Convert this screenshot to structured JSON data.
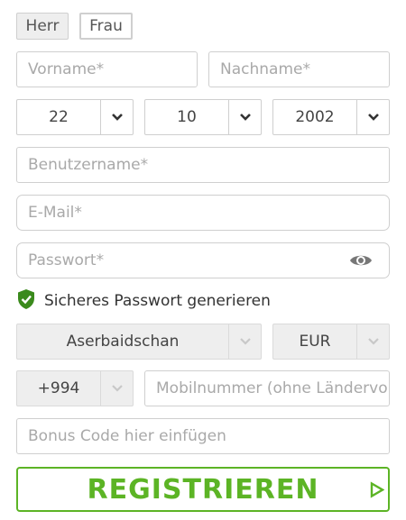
{
  "gender": {
    "options": [
      "Herr",
      "Frau"
    ],
    "selected": "Frau"
  },
  "first_name": {
    "placeholder": "Vorname*"
  },
  "last_name": {
    "placeholder": "Nachname*"
  },
  "birthdate": {
    "day": "22",
    "month": "10",
    "year": "2002"
  },
  "username": {
    "placeholder": "Benutzername*"
  },
  "email": {
    "placeholder": "E-Mail*"
  },
  "password": {
    "placeholder": "Passwort*"
  },
  "generate_password": {
    "label": "Sicheres Passwort generieren"
  },
  "country": {
    "value": "Aserbaidschan"
  },
  "currency": {
    "value": "EUR"
  },
  "phone_code": {
    "value": "+994"
  },
  "mobile": {
    "placeholder": "Mobilnummer (ohne Ländervorwahl)"
  },
  "bonus_code": {
    "placeholder": "Bonus Code hier einfügen"
  },
  "register": {
    "label": "REGISTRIEREN"
  },
  "colors": {
    "accent": "#5cb425",
    "shield": "#3a8a1c",
    "border": "#cfcfcf",
    "disabled_bg": "#eeeeee"
  }
}
